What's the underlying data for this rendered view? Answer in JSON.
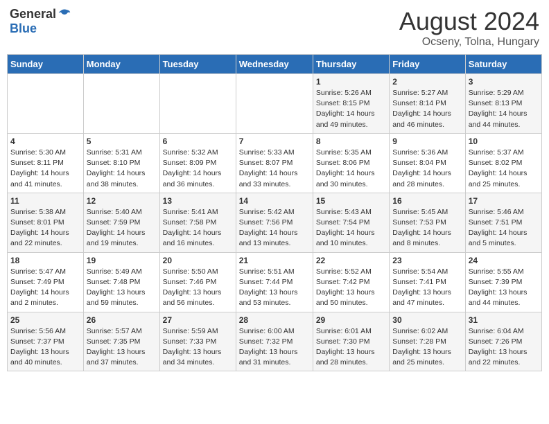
{
  "header": {
    "logo_general": "General",
    "logo_blue": "Blue",
    "month_year": "August 2024",
    "location": "Ocseny, Tolna, Hungary"
  },
  "weekdays": [
    "Sunday",
    "Monday",
    "Tuesday",
    "Wednesday",
    "Thursday",
    "Friday",
    "Saturday"
  ],
  "weeks": [
    [
      {
        "day": "",
        "info": ""
      },
      {
        "day": "",
        "info": ""
      },
      {
        "day": "",
        "info": ""
      },
      {
        "day": "",
        "info": ""
      },
      {
        "day": "1",
        "info": "Sunrise: 5:26 AM\nSunset: 8:15 PM\nDaylight: 14 hours\nand 49 minutes."
      },
      {
        "day": "2",
        "info": "Sunrise: 5:27 AM\nSunset: 8:14 PM\nDaylight: 14 hours\nand 46 minutes."
      },
      {
        "day": "3",
        "info": "Sunrise: 5:29 AM\nSunset: 8:13 PM\nDaylight: 14 hours\nand 44 minutes."
      }
    ],
    [
      {
        "day": "4",
        "info": "Sunrise: 5:30 AM\nSunset: 8:11 PM\nDaylight: 14 hours\nand 41 minutes."
      },
      {
        "day": "5",
        "info": "Sunrise: 5:31 AM\nSunset: 8:10 PM\nDaylight: 14 hours\nand 38 minutes."
      },
      {
        "day": "6",
        "info": "Sunrise: 5:32 AM\nSunset: 8:09 PM\nDaylight: 14 hours\nand 36 minutes."
      },
      {
        "day": "7",
        "info": "Sunrise: 5:33 AM\nSunset: 8:07 PM\nDaylight: 14 hours\nand 33 minutes."
      },
      {
        "day": "8",
        "info": "Sunrise: 5:35 AM\nSunset: 8:06 PM\nDaylight: 14 hours\nand 30 minutes."
      },
      {
        "day": "9",
        "info": "Sunrise: 5:36 AM\nSunset: 8:04 PM\nDaylight: 14 hours\nand 28 minutes."
      },
      {
        "day": "10",
        "info": "Sunrise: 5:37 AM\nSunset: 8:02 PM\nDaylight: 14 hours\nand 25 minutes."
      }
    ],
    [
      {
        "day": "11",
        "info": "Sunrise: 5:38 AM\nSunset: 8:01 PM\nDaylight: 14 hours\nand 22 minutes."
      },
      {
        "day": "12",
        "info": "Sunrise: 5:40 AM\nSunset: 7:59 PM\nDaylight: 14 hours\nand 19 minutes."
      },
      {
        "day": "13",
        "info": "Sunrise: 5:41 AM\nSunset: 7:58 PM\nDaylight: 14 hours\nand 16 minutes."
      },
      {
        "day": "14",
        "info": "Sunrise: 5:42 AM\nSunset: 7:56 PM\nDaylight: 14 hours\nand 13 minutes."
      },
      {
        "day": "15",
        "info": "Sunrise: 5:43 AM\nSunset: 7:54 PM\nDaylight: 14 hours\nand 10 minutes."
      },
      {
        "day": "16",
        "info": "Sunrise: 5:45 AM\nSunset: 7:53 PM\nDaylight: 14 hours\nand 8 minutes."
      },
      {
        "day": "17",
        "info": "Sunrise: 5:46 AM\nSunset: 7:51 PM\nDaylight: 14 hours\nand 5 minutes."
      }
    ],
    [
      {
        "day": "18",
        "info": "Sunrise: 5:47 AM\nSunset: 7:49 PM\nDaylight: 14 hours\nand 2 minutes."
      },
      {
        "day": "19",
        "info": "Sunrise: 5:49 AM\nSunset: 7:48 PM\nDaylight: 13 hours\nand 59 minutes."
      },
      {
        "day": "20",
        "info": "Sunrise: 5:50 AM\nSunset: 7:46 PM\nDaylight: 13 hours\nand 56 minutes."
      },
      {
        "day": "21",
        "info": "Sunrise: 5:51 AM\nSunset: 7:44 PM\nDaylight: 13 hours\nand 53 minutes."
      },
      {
        "day": "22",
        "info": "Sunrise: 5:52 AM\nSunset: 7:42 PM\nDaylight: 13 hours\nand 50 minutes."
      },
      {
        "day": "23",
        "info": "Sunrise: 5:54 AM\nSunset: 7:41 PM\nDaylight: 13 hours\nand 47 minutes."
      },
      {
        "day": "24",
        "info": "Sunrise: 5:55 AM\nSunset: 7:39 PM\nDaylight: 13 hours\nand 44 minutes."
      }
    ],
    [
      {
        "day": "25",
        "info": "Sunrise: 5:56 AM\nSunset: 7:37 PM\nDaylight: 13 hours\nand 40 minutes."
      },
      {
        "day": "26",
        "info": "Sunrise: 5:57 AM\nSunset: 7:35 PM\nDaylight: 13 hours\nand 37 minutes."
      },
      {
        "day": "27",
        "info": "Sunrise: 5:59 AM\nSunset: 7:33 PM\nDaylight: 13 hours\nand 34 minutes."
      },
      {
        "day": "28",
        "info": "Sunrise: 6:00 AM\nSunset: 7:32 PM\nDaylight: 13 hours\nand 31 minutes."
      },
      {
        "day": "29",
        "info": "Sunrise: 6:01 AM\nSunset: 7:30 PM\nDaylight: 13 hours\nand 28 minutes."
      },
      {
        "day": "30",
        "info": "Sunrise: 6:02 AM\nSunset: 7:28 PM\nDaylight: 13 hours\nand 25 minutes."
      },
      {
        "day": "31",
        "info": "Sunrise: 6:04 AM\nSunset: 7:26 PM\nDaylight: 13 hours\nand 22 minutes."
      }
    ]
  ]
}
